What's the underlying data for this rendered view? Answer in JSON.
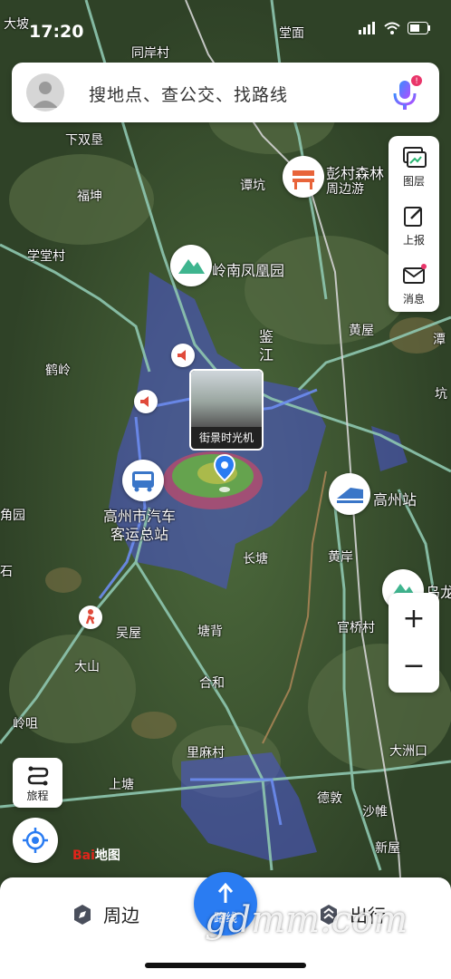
{
  "status": {
    "time": "17:20"
  },
  "search": {
    "placeholder": "搜地点、查公交、找路线"
  },
  "tools": [
    {
      "label": "图层",
      "icon": "layers-icon"
    },
    {
      "label": "上报",
      "icon": "report-icon"
    },
    {
      "label": "消息",
      "icon": "message-icon"
    }
  ],
  "zoom": {
    "in": "+",
    "out": "−"
  },
  "trip": {
    "label": "旅程"
  },
  "logo": {
    "text": "Bai",
    "text2": "地图"
  },
  "streetview": {
    "label": "街景时光机"
  },
  "bottom": {
    "nearby": "周边",
    "route": "路线",
    "travel": "出行"
  },
  "watermark": "gdmm.com",
  "map": {
    "places": [
      "大坡",
      "堂面",
      "同岸村",
      "下双垦",
      "福坤",
      "谭坑",
      "彭村森林",
      "周边游",
      "学堂村",
      "岭南凤凰园",
      "鉴",
      "江",
      "鹤岭",
      "黄屋",
      "高州市汽车",
      "客运总站",
      "高州站",
      "长塘",
      "黄岸",
      "官桥村",
      "吴屋",
      "大山",
      "塘背",
      "合和",
      "里麻村",
      "上塘",
      "大洲口",
      "岭咀",
      "德敦",
      "沙帷",
      "新屋",
      "乌龙",
      "坑",
      "潭",
      "角园",
      "石"
    ]
  },
  "colors": {
    "accent": "#2a7cf2",
    "heat": "#4b54d6"
  }
}
